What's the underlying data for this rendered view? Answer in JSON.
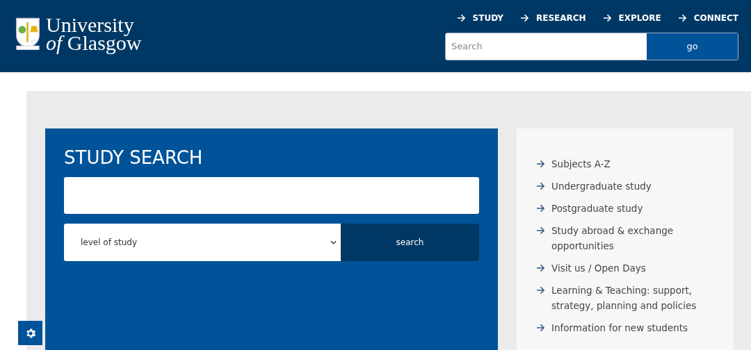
{
  "header": {
    "logo": {
      "line_1": "University",
      "line_2": "*of* Glasgow"
    },
    "nav": [
      "STUDY",
      "RESEARCH",
      "EXPLORE",
      "CONNECT"
    ],
    "search": {
      "placeholder": "Search",
      "button": "go"
    }
  },
  "study_search": {
    "title": "STUDY SEARCH",
    "level_select": "level of study",
    "button": "search"
  },
  "links": [
    "Subjects A-Z",
    "Undergraduate study",
    "Postgraduate study",
    "Study abroad & exchange opportunities",
    "Visit us / Open Days",
    "Learning & Teaching: support, strategy, planning and policies",
    "Information for new students"
  ]
}
